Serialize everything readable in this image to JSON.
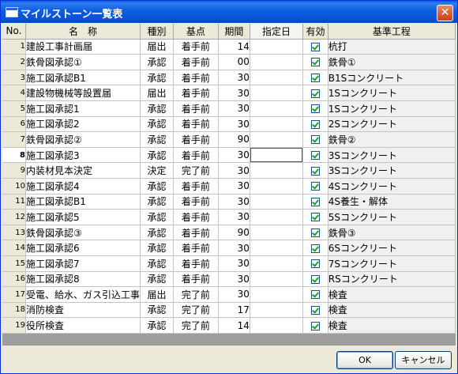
{
  "window": {
    "title": "マイルストーン一覧表",
    "close_glyph": "✕"
  },
  "columns": [
    "No.",
    "名　称",
    "種別",
    "基点",
    "期間",
    "指定日",
    "有効",
    "基準工程"
  ],
  "rows": [
    {
      "no": "1",
      "name": "建設工事計画届",
      "kind": "届出",
      "base": "着手前",
      "days": "14",
      "date": "",
      "valid": true,
      "standard": "杭打"
    },
    {
      "no": "2",
      "name": "鉄骨図承認①",
      "kind": "承認",
      "base": "着手前",
      "days": "00",
      "date": "",
      "valid": true,
      "standard": "鉄骨①"
    },
    {
      "no": "3",
      "name": "施工図承認B1",
      "kind": "承認",
      "base": "着手前",
      "days": "30",
      "date": "",
      "valid": true,
      "standard": "B1Sコンクリート"
    },
    {
      "no": "4",
      "name": "建設物機械等設置届",
      "kind": "届出",
      "base": "着手前",
      "days": "30",
      "date": "",
      "valid": true,
      "standard": "1Sコンクリート"
    },
    {
      "no": "5",
      "name": "施工図承認1",
      "kind": "承認",
      "base": "着手前",
      "days": "30",
      "date": "",
      "valid": true,
      "standard": "1Sコンクリート"
    },
    {
      "no": "6",
      "name": "施工図承認2",
      "kind": "承認",
      "base": "着手前",
      "days": "30",
      "date": "",
      "valid": true,
      "standard": "2Sコンクリート"
    },
    {
      "no": "7",
      "name": "鉄骨図承認②",
      "kind": "承認",
      "base": "着手前",
      "days": "90",
      "date": "",
      "valid": true,
      "standard": "鉄骨②"
    },
    {
      "no": "8",
      "name": "施工図承認3",
      "kind": "承認",
      "base": "着手前",
      "days": "30",
      "date": "",
      "valid": true,
      "standard": "3Sコンクリート"
    },
    {
      "no": "9",
      "name": "内装材見本決定",
      "kind": "決定",
      "base": "完了前",
      "days": "30",
      "date": "",
      "valid": true,
      "standard": "3Sコンクリート"
    },
    {
      "no": "10",
      "name": "施工図承認4",
      "kind": "承認",
      "base": "着手前",
      "days": "30",
      "date": "",
      "valid": true,
      "standard": "4Sコンクリート"
    },
    {
      "no": "11",
      "name": "施工図承認B1",
      "kind": "承認",
      "base": "着手前",
      "days": "30",
      "date": "",
      "valid": true,
      "standard": "4S養生・解体"
    },
    {
      "no": "12",
      "name": "施工図承認5",
      "kind": "承認",
      "base": "着手前",
      "days": "30",
      "date": "",
      "valid": true,
      "standard": "5Sコンクリート"
    },
    {
      "no": "13",
      "name": "鉄骨図承認③",
      "kind": "承認",
      "base": "着手前",
      "days": "90",
      "date": "",
      "valid": true,
      "standard": "鉄骨③"
    },
    {
      "no": "14",
      "name": "施工図承認6",
      "kind": "承認",
      "base": "着手前",
      "days": "30",
      "date": "",
      "valid": true,
      "standard": "6Sコンクリート"
    },
    {
      "no": "15",
      "name": "施工図承認7",
      "kind": "承認",
      "base": "着手前",
      "days": "30",
      "date": "",
      "valid": true,
      "standard": "7Sコンクリート"
    },
    {
      "no": "16",
      "name": "施工図承認8",
      "kind": "承認",
      "base": "着手前",
      "days": "30",
      "date": "",
      "valid": true,
      "standard": "RSコンクリート"
    },
    {
      "no": "17",
      "name": "受電、給水、ガス引込工事",
      "kind": "届出",
      "base": "完了前",
      "days": "30",
      "date": "",
      "valid": true,
      "standard": "検査"
    },
    {
      "no": "18",
      "name": "消防検査",
      "kind": "承認",
      "base": "完了前",
      "days": "17",
      "date": "",
      "valid": true,
      "standard": "検査"
    },
    {
      "no": "19",
      "name": "役所検査",
      "kind": "承認",
      "base": "完了前",
      "days": "14",
      "date": "",
      "valid": true,
      "standard": "検査"
    }
  ],
  "buttons": {
    "ok": "OK",
    "cancel": "キャンセル"
  }
}
